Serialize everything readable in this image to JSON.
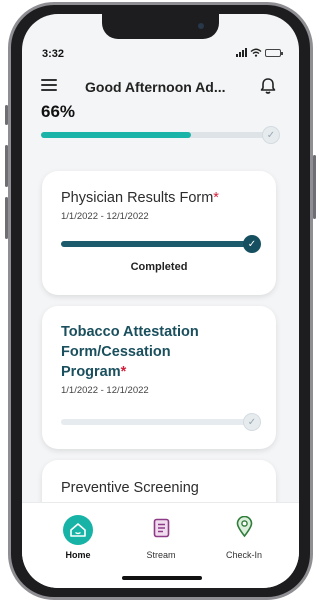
{
  "status": {
    "time": "3:32"
  },
  "header": {
    "greeting": "Good Afternoon Ad..."
  },
  "progress": {
    "label": "66%",
    "value": 0.66
  },
  "cards": [
    {
      "title": "Physician Results Form",
      "required_mark": "*",
      "dates": "1/1/2022 - 12/1/2022",
      "progress": 1.0,
      "status": "Completed"
    },
    {
      "title_line1": "Tobacco Attestation",
      "title_line2": "Form/Cessation",
      "title_line3": "Program",
      "required_mark": "*",
      "dates": "1/1/2022 - 12/1/2022",
      "progress": 0.0
    },
    {
      "title": "Preventive Screening"
    }
  ],
  "tabs": [
    {
      "label": "Home",
      "icon": "home-icon",
      "active": true
    },
    {
      "label": "Stream",
      "icon": "document-icon",
      "active": false
    },
    {
      "label": "Check-In",
      "icon": "location-pin-icon",
      "active": false
    }
  ],
  "colors": {
    "accent": "#16b3a6",
    "dark_teal": "#1b5b6c",
    "required": "#d21f3c",
    "stream_icon": "#8e3b87",
    "checkin_icon": "#2f7d3a"
  }
}
